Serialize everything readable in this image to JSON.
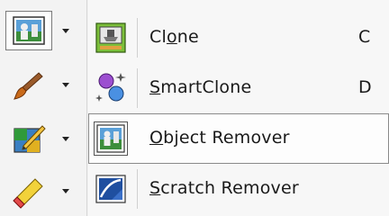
{
  "toolbar": {
    "tools": [
      {
        "name": "object-remover-tool",
        "icon": "object-remover-icon",
        "selected": true
      },
      {
        "name": "brush-tool",
        "icon": "brush-icon",
        "selected": false
      },
      {
        "name": "color-pencil-tool",
        "icon": "pencil-palette-icon",
        "selected": false
      },
      {
        "name": "eraser-tool",
        "icon": "eraser-icon",
        "selected": false
      }
    ],
    "arrow_icon": "dropdown-arrow-icon"
  },
  "menu": {
    "items": [
      {
        "label_pre": "Cl",
        "mnemonic": "o",
        "label_post": "ne",
        "shortcut": "C",
        "icon": "clone-stamp-icon"
      },
      {
        "label_pre": "",
        "mnemonic": "S",
        "label_post": "martClone",
        "shortcut": "D",
        "icon": "smartclone-icon"
      },
      {
        "label_pre": "",
        "mnemonic": "O",
        "label_post": "bject Remover",
        "shortcut": "",
        "icon": "object-remover-icon",
        "highlighted": true
      },
      {
        "label_pre": "",
        "mnemonic": "S",
        "label_post": "cratch Remover",
        "shortcut": "",
        "icon": "scratch-remover-icon"
      }
    ]
  },
  "colors": {
    "highlight_border": "#8a8a8a",
    "menu_bg": "#f7f7f7"
  }
}
